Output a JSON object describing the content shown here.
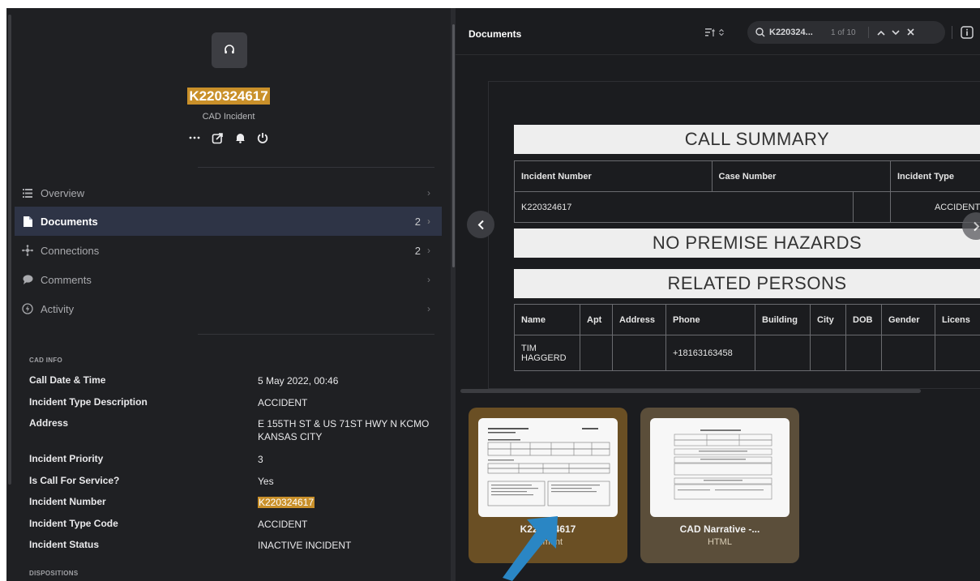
{
  "entity": {
    "title": "K220324617",
    "subtitle": "CAD Incident",
    "actions": [
      "more-icon",
      "share-icon",
      "bell-icon",
      "power-icon"
    ]
  },
  "nav": [
    {
      "label": "Overview",
      "count": "",
      "icon": "list-icon"
    },
    {
      "label": "Documents",
      "count": "2",
      "icon": "document-icon",
      "active": true
    },
    {
      "label": "Connections",
      "count": "2",
      "icon": "connections-icon"
    },
    {
      "label": "Comments",
      "count": "",
      "icon": "comment-icon"
    },
    {
      "label": "Activity",
      "count": "",
      "icon": "activity-icon"
    }
  ],
  "cad_info": {
    "section_label": "CAD INFO",
    "rows": [
      {
        "key": "Call Date & Time",
        "value": "5 May 2022, 00:46"
      },
      {
        "key": "Incident Type Description",
        "value": "ACCIDENT"
      },
      {
        "key": "Address",
        "value": "E 155TH ST & US 71ST HWY N KCMO KANSAS CITY"
      },
      {
        "key": "Incident Priority",
        "value": "3"
      },
      {
        "key": "Is Call For Service?",
        "value": "Yes"
      },
      {
        "key": "Incident Number",
        "value": "K220324617"
      },
      {
        "key": "Incident Type Code",
        "value": "ACCIDENT"
      },
      {
        "key": "Incident Status",
        "value": "INACTIVE INCIDENT"
      }
    ],
    "next_section_label": "DISPOSITIONS"
  },
  "documents": {
    "title": "Documents",
    "search": {
      "query": "K220324...",
      "count": "1 of 10"
    },
    "page": {
      "banner_summary": "CALL SUMMARY",
      "summary_headers": [
        "Incident Number",
        "Case Number",
        "Incident Type"
      ],
      "summary_values": [
        "K220324617",
        "",
        "ACCIDENT"
      ],
      "banner_hazards": "NO PREMISE HAZARDS",
      "banner_persons": "RELATED PERSONS",
      "person_headers": [
        "Name",
        "Apt",
        "Address",
        "Phone",
        "Building",
        "City",
        "DOB",
        "Gender",
        "Licens"
      ],
      "person_values": [
        "TIM HAGGERD",
        "",
        "",
        "+18163163458",
        "",
        "",
        "",
        "",
        ""
      ]
    },
    "thumbnails": [
      {
        "name": "K220324617",
        "type": "chment"
      },
      {
        "name": "CAD Narrative -...",
        "type": "HTML"
      }
    ]
  },
  "colors": {
    "highlight": "#c9902a",
    "active_nav": "#2e3446",
    "panel": "#1f2023"
  }
}
